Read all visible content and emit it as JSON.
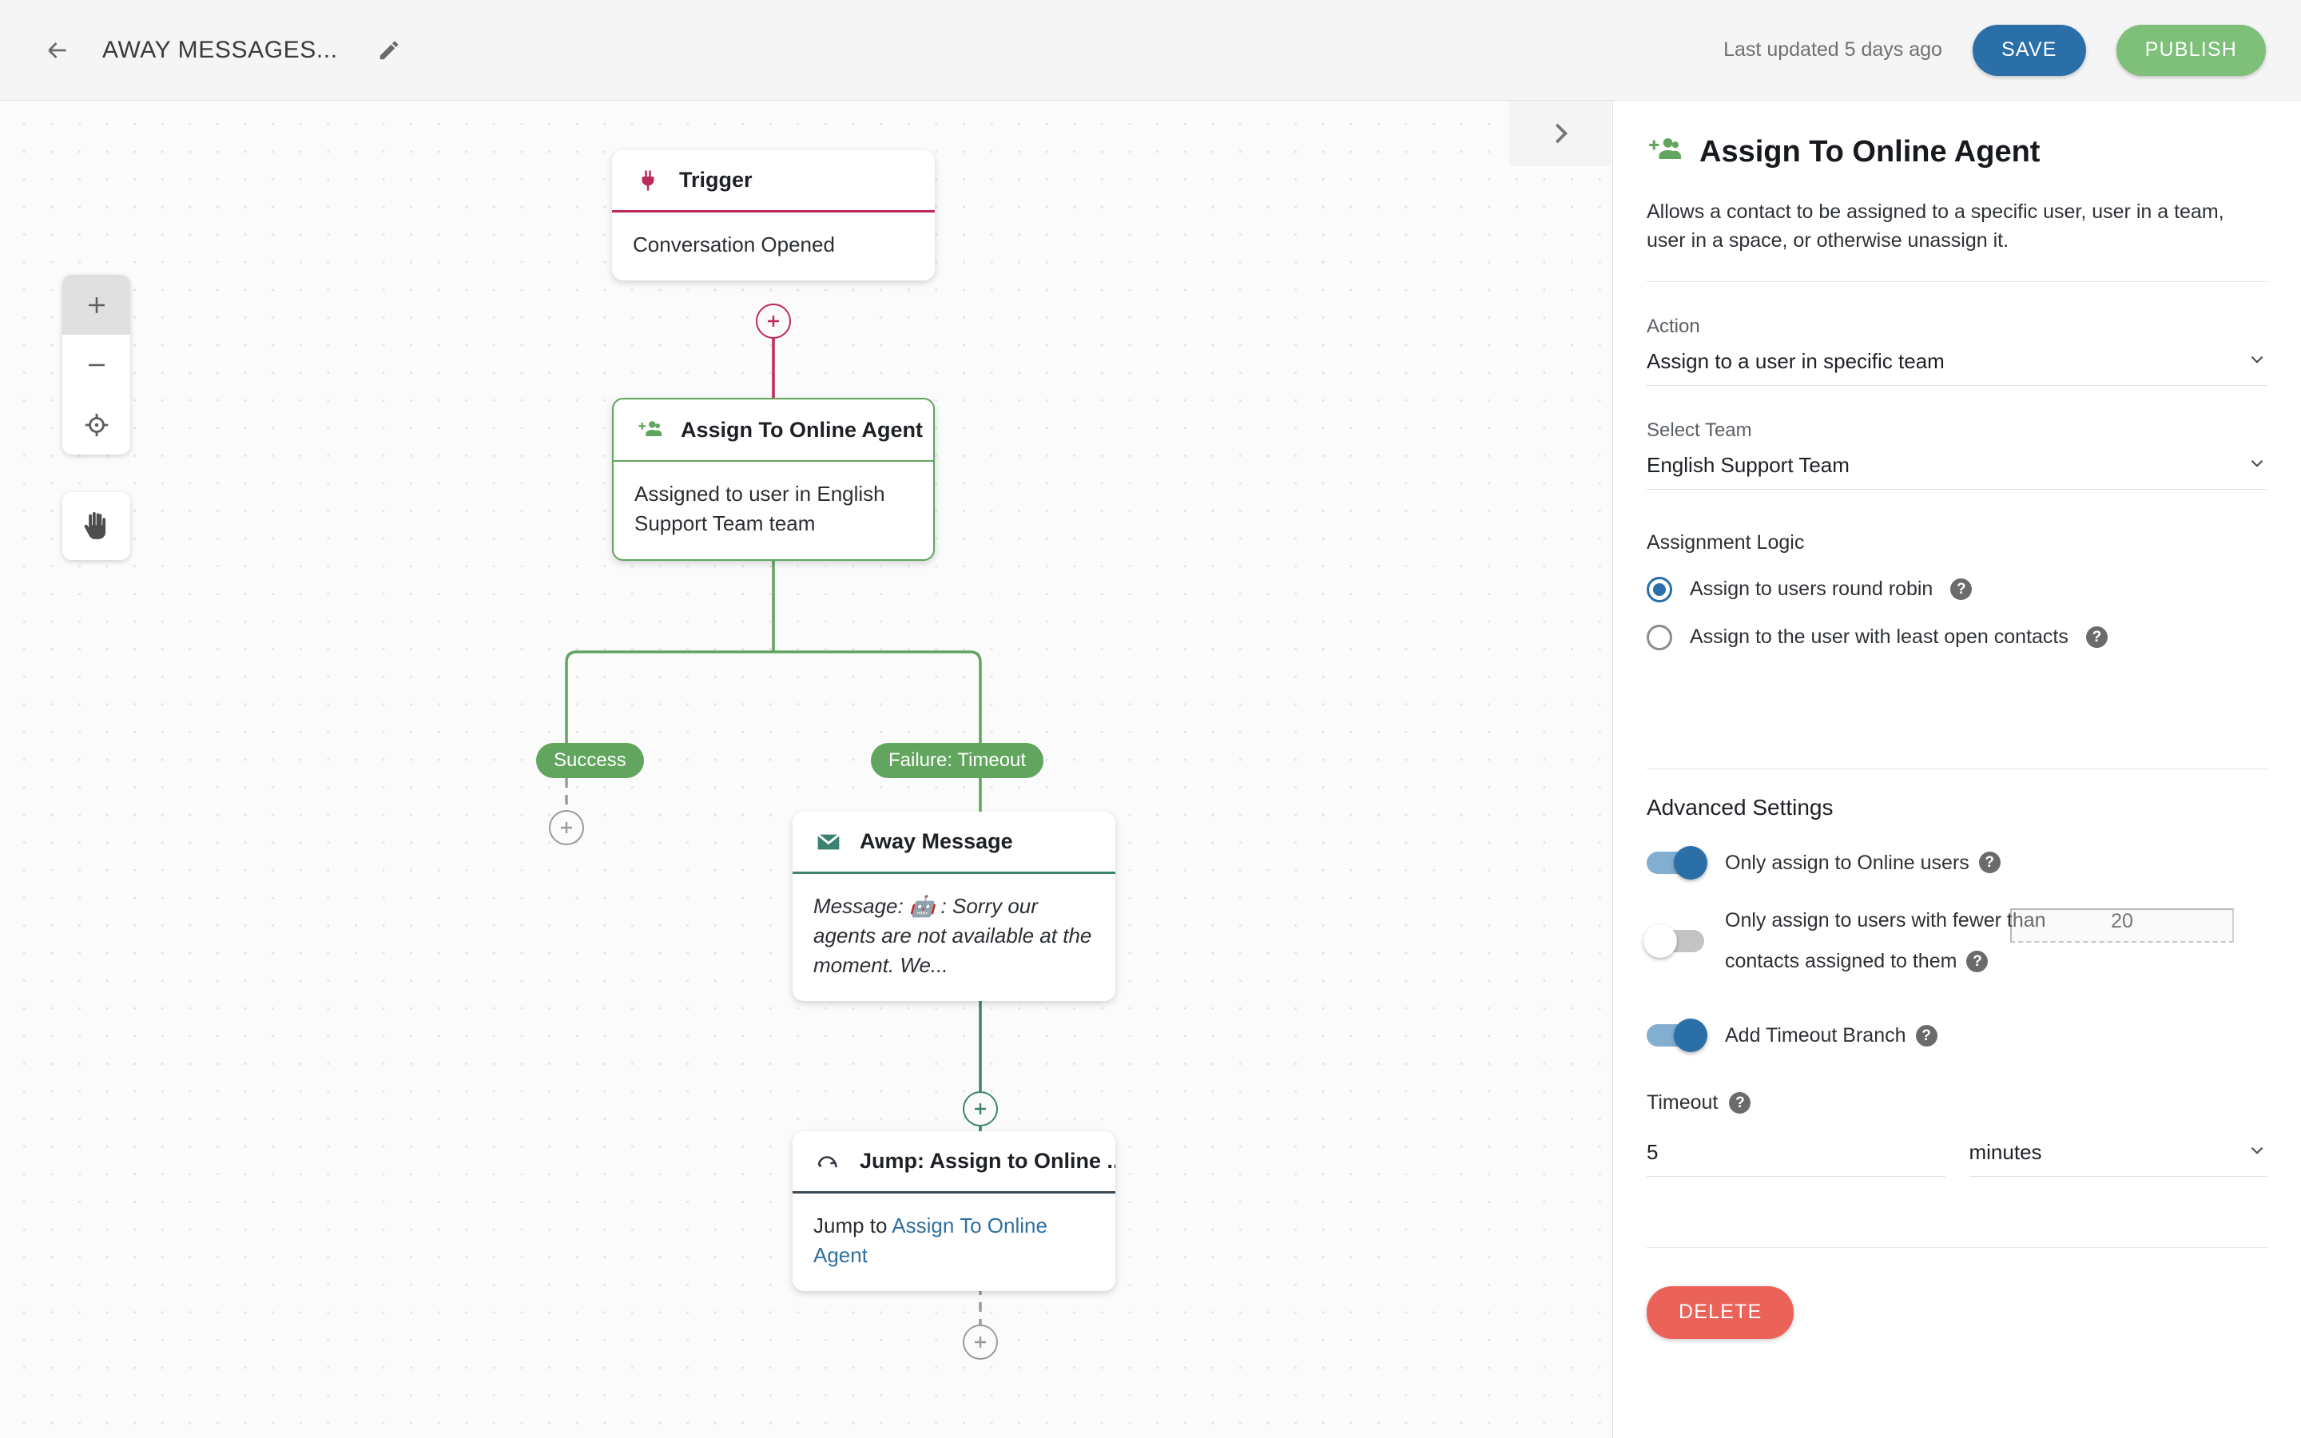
{
  "topbar": {
    "back_icon": "arrow-left-icon",
    "title": "AWAY MESSAGES...",
    "edit_icon": "pencil-icon",
    "last_updated": "Last updated 5 days ago",
    "save_label": "SAVE",
    "publish_label": "PUBLISH",
    "save_color": "#2a6fa8",
    "publish_color": "#7ec07a"
  },
  "canvas": {
    "zoom_in_icon": "plus-icon",
    "zoom_out_icon": "minus-icon",
    "recenter_icon": "crosshair-icon",
    "pan_icon": "hand-icon",
    "collapse_icon": "chevron-right-icon",
    "nodes": [
      {
        "id": "trigger",
        "icon": "plug-icon",
        "title": "Trigger",
        "body": "Conversation Opened",
        "accent": "#bc2a5b"
      },
      {
        "id": "assign",
        "icon": "person-add-icon",
        "title": "Assign To Online Agent",
        "body": "Assigned to user in English Support Team team",
        "accent": "#61a55e"
      },
      {
        "id": "away",
        "icon": "envelope-icon",
        "title": "Away Message",
        "body": "Message: 🤖 : Sorry our agents are not available at the moment. We...",
        "accent": "#3c8270"
      },
      {
        "id": "jump",
        "icon": "jump-arrow-icon",
        "title": "Jump: Assign to Online ...",
        "body_prefix": "Jump to ",
        "body_link": "Assign To Online Agent",
        "accent": "#3c4a57"
      }
    ],
    "branches": [
      {
        "label": "Success",
        "color": "#61a55e"
      },
      {
        "label": "Failure: Timeout",
        "color": "#61a55e"
      }
    ],
    "add_icon": "plus-circle-icon"
  },
  "panel": {
    "icon": "person-add-icon",
    "title": "Assign To Online Agent",
    "description": "Allows a contact to be assigned to a specific user, user in a team, user in a space, or otherwise unassign it.",
    "action": {
      "label": "Action",
      "value": "Assign to a user in specific team",
      "chevron": "chevron-down-icon"
    },
    "team": {
      "label": "Select Team",
      "value": "English Support Team",
      "chevron": "chevron-down-icon"
    },
    "assignment_logic": {
      "label": "Assignment Logic",
      "options": [
        {
          "label": "Assign to users round robin",
          "selected": true,
          "help": "help-icon"
        },
        {
          "label": "Assign to the user with least open contacts",
          "selected": false,
          "help": "help-icon"
        }
      ],
      "accent": "#2a6fa8"
    },
    "advanced": {
      "title": "Advanced Settings",
      "toggles": [
        {
          "label": "Only assign to Online users",
          "on": true,
          "help": "help-icon"
        },
        {
          "label_part1": "Only assign to users with fewer than",
          "label_part2": "contacts assigned to them",
          "on": false,
          "help": "help-icon",
          "value": "",
          "placeholder": "20"
        },
        {
          "label": "Add Timeout Branch",
          "on": true,
          "help": "help-icon"
        }
      ]
    },
    "timeout": {
      "label": "Timeout",
      "help": "help-icon",
      "value": "5",
      "unit": "minutes",
      "chevron": "chevron-down-icon"
    },
    "delete_label": "DELETE",
    "delete_color": "#eb6258"
  }
}
